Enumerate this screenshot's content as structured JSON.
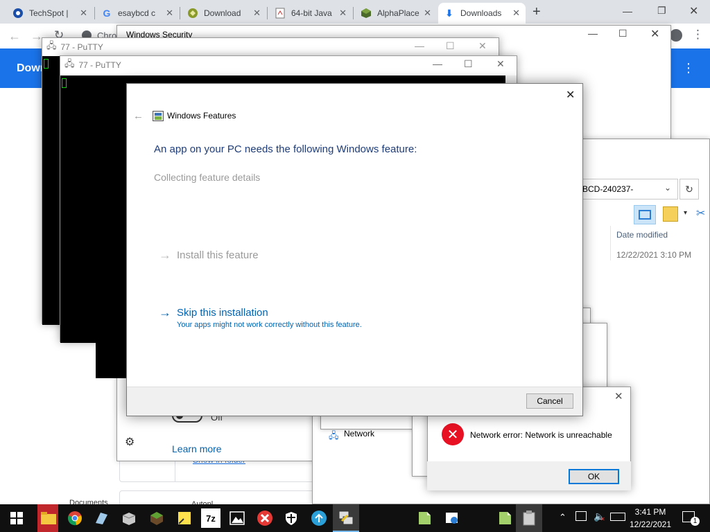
{
  "browser": {
    "tabs": [
      {
        "label": "TechSpot |",
        "icon": "techspot-icon"
      },
      {
        "label": "esaybcd c",
        "icon": "google-icon"
      },
      {
        "label": "Download",
        "icon": "download-site-icon"
      },
      {
        "label": "64-bit Java",
        "icon": "java-page-icon"
      },
      {
        "label": "AlphaPlace",
        "icon": "alphaplace-icon"
      },
      {
        "label": "Downloads",
        "icon": "download-icon"
      }
    ],
    "new_tab": "+",
    "address_fragment": "Chro",
    "page_heading": "Down",
    "colors": {
      "accent": "#1a73e8",
      "tabstrip": "#dee1e6"
    }
  },
  "windows_security": {
    "title": "Windows Security",
    "toggle_label": "Off",
    "learn_more": "Learn more"
  },
  "downloads_list": {
    "show_in_folder": "Show in folder",
    "item_fragment_1": "Documents",
    "item_fragment_2": "Autopl"
  },
  "putty1": {
    "title": "77 - PuTTY"
  },
  "putty2": {
    "title": "77 - PuTTY"
  },
  "explorer": {
    "path": "BCD-240237-",
    "column_date": "Date modified",
    "row_date": "12/22/2021 3:10 PM",
    "nav_network": "Network"
  },
  "windows_features": {
    "title": "Windows Features",
    "heading": "An app on your PC needs the following Windows feature:",
    "status": "Collecting feature details",
    "install_option": "Install this feature",
    "skip_option": "Skip this installation",
    "skip_note": "Your apps might not work correctly without this feature.",
    "cancel": "Cancel",
    "colors": {
      "heading": "#1e3c78",
      "link": "#0063b1",
      "disabled": "#9a9a9a"
    }
  },
  "error_dialog": {
    "message": "Network error: Network is unreachable",
    "ok": "OK"
  },
  "taskbar": {
    "time": "3:41 PM",
    "date": "12/22/2021",
    "notification_count": "1",
    "apps": [
      "start-icon",
      "file-explorer-icon",
      "chrome-icon",
      "app-icon",
      "box-icon",
      "minecraft-icon",
      "sticky-notes-icon",
      "7zip-icon",
      "photos-icon",
      "red-x-app-icon",
      "security-icon",
      "network-app-icon",
      "putty-icon",
      "notepad-icon",
      "remote-icon",
      "notepad-2-icon",
      "installer-icon"
    ]
  }
}
